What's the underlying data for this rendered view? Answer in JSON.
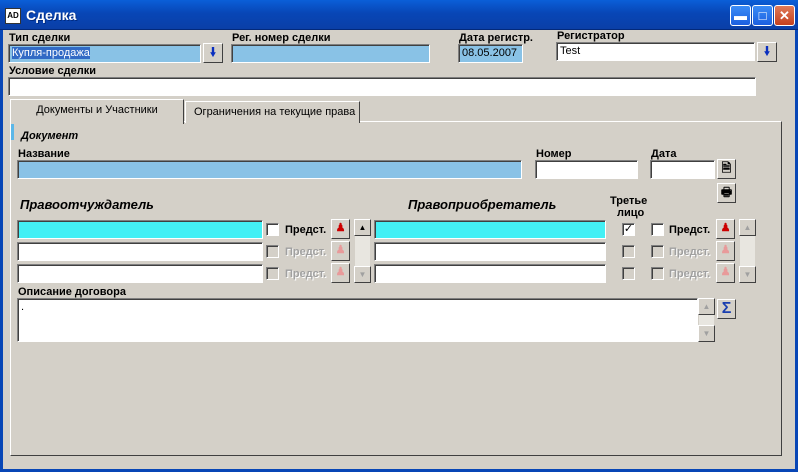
{
  "window": {
    "title": "Сделка",
    "icon": "app-icon",
    "buttons": [
      "minimize-icon",
      "maximize-icon",
      "close-icon"
    ]
  },
  "deal": {
    "type_label": "Тип сделки",
    "type_value": "Купля-продажа",
    "reg_number_label": "Рег. номер сделки",
    "reg_number_value": "",
    "reg_date_label": "Дата регистр.",
    "reg_date_value": "08.05.2007",
    "registrar_label": "Регистратор",
    "registrar_value": "Test",
    "condition_label": "Условие сделки",
    "condition_value": ""
  },
  "tabs": [
    {
      "label": "Документы и Участники",
      "active": true
    },
    {
      "label": "Ограничения на текущие права",
      "active": false
    }
  ],
  "document": {
    "section_label": "Документ",
    "name_label": "Название",
    "name_value": "",
    "number_label": "Номер",
    "number_value": "",
    "date_label": "Дата",
    "date_value": ""
  },
  "parties": {
    "alienator_label": "Правоотчуждатель",
    "acquirer_label": "Правоприобретатель",
    "third_party_label_1": "Третье",
    "third_party_label_2": "лицо",
    "rep_label": "Предст.",
    "alienators": [
      {
        "value": "",
        "rep_checked": false,
        "enabled": true
      },
      {
        "value": "",
        "rep_checked": false,
        "enabled": false
      },
      {
        "value": "",
        "rep_checked": false,
        "enabled": false
      }
    ],
    "acquirers": [
      {
        "value": "",
        "third_party": true,
        "rep_checked": false,
        "enabled": true
      },
      {
        "value": "",
        "third_party": false,
        "rep_checked": false,
        "enabled": false
      },
      {
        "value": "",
        "third_party": false,
        "rep_checked": false,
        "enabled": false
      }
    ]
  },
  "contract": {
    "description_label": "Описание договора",
    "description_value": "."
  },
  "colors": {
    "titlebar": "#0846b6",
    "blue_field": "#89c2e6",
    "cyan_field": "#43f0f5",
    "face": "#d4d0c8"
  }
}
